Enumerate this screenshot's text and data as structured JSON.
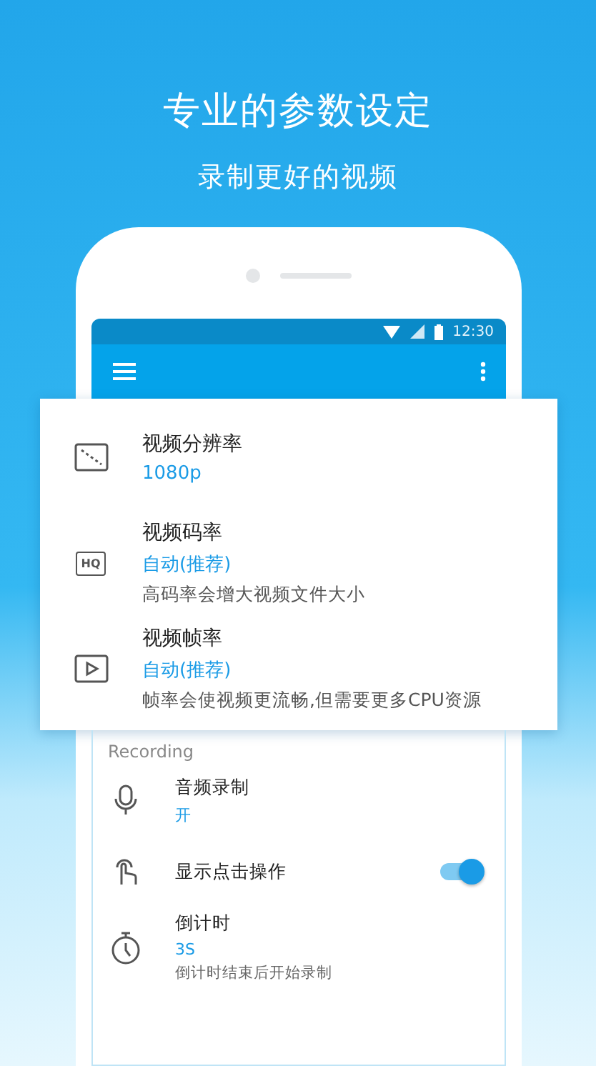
{
  "headline": "专业的参数设定",
  "subheadline": "录制更好的视频",
  "status_bar": {
    "time": "12:30"
  },
  "popup_items": [
    {
      "title": "视频分辨率",
      "value": "1080p"
    },
    {
      "badge": "HQ",
      "title": "视频码率",
      "value": "自动(推荐)",
      "note": "高码率会增大视频文件大小"
    },
    {
      "title": "视频帧率",
      "value": "自动(推荐)",
      "note": "帧率会使视频更流畅,但需要更多CPU资源"
    }
  ],
  "section": "Recording",
  "settings": [
    {
      "kind": "value",
      "title": "音频录制",
      "value": "开"
    },
    {
      "kind": "toggle",
      "title": "显示点击操作",
      "on": true
    },
    {
      "kind": "value",
      "title": "倒计时",
      "value": "3S",
      "note": "倒计时结束后开始录制"
    }
  ]
}
